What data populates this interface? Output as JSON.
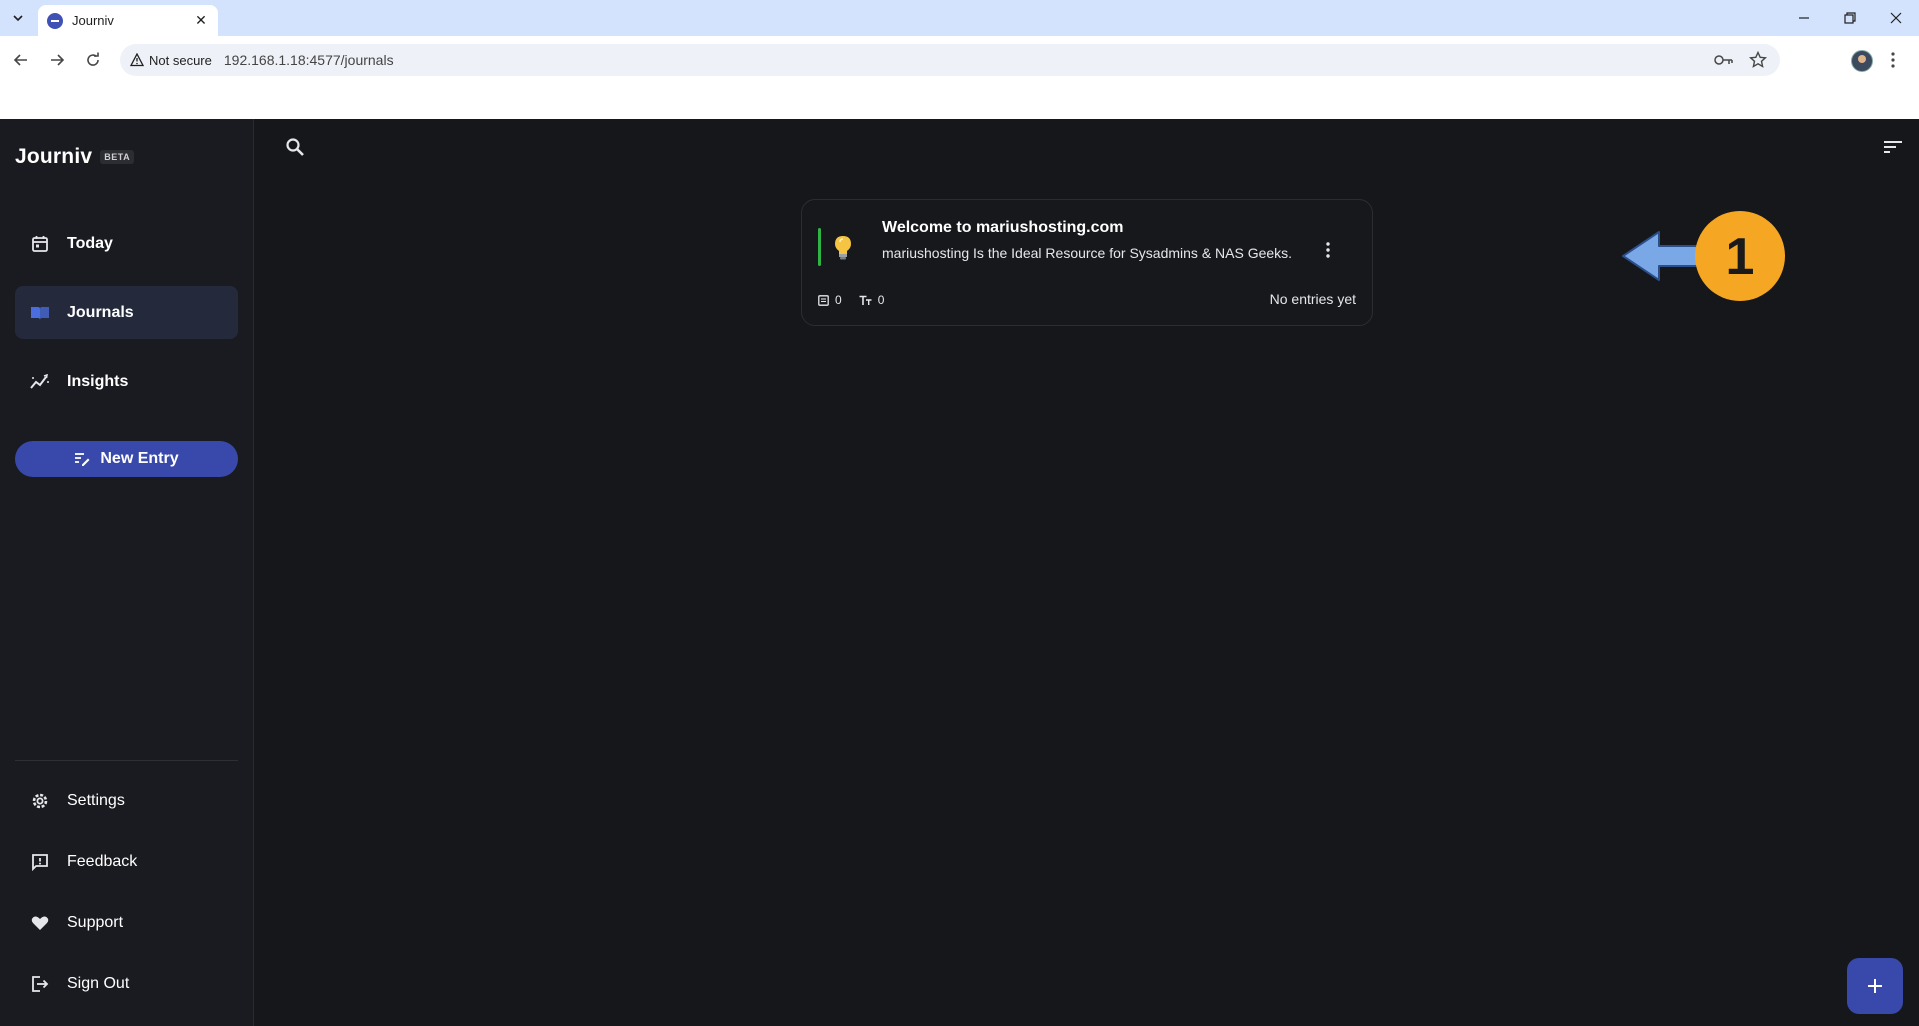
{
  "browser": {
    "tab_title": "Journiv",
    "security_label": "Not secure",
    "url": "192.168.1.18:4577/journals"
  },
  "app": {
    "brand": "Journiv",
    "badge": "BETA",
    "nav": {
      "today": "Today",
      "journals": "Journals",
      "insights": "Insights"
    },
    "new_entry": "New Entry",
    "footer": {
      "settings": "Settings",
      "feedback": "Feedback",
      "support": "Support",
      "sign_out": "Sign Out"
    }
  },
  "journal": {
    "title": "Welcome to mariushosting.com",
    "description": "mariushosting Is the Ideal Resource for Sysadmins & NAS Geeks.",
    "entries_count": "0",
    "words_count": "0",
    "status": "No entries yet",
    "emoji": "lightbulb-icon",
    "accent_color": "#2fb344"
  },
  "annotation": {
    "number": "1",
    "arrow_color": "#7aa7e6",
    "badge_color": "#f5a623"
  },
  "colors": {
    "primary": "#3949ab",
    "background": "#16171b",
    "sidebar": "#1a1b20"
  }
}
